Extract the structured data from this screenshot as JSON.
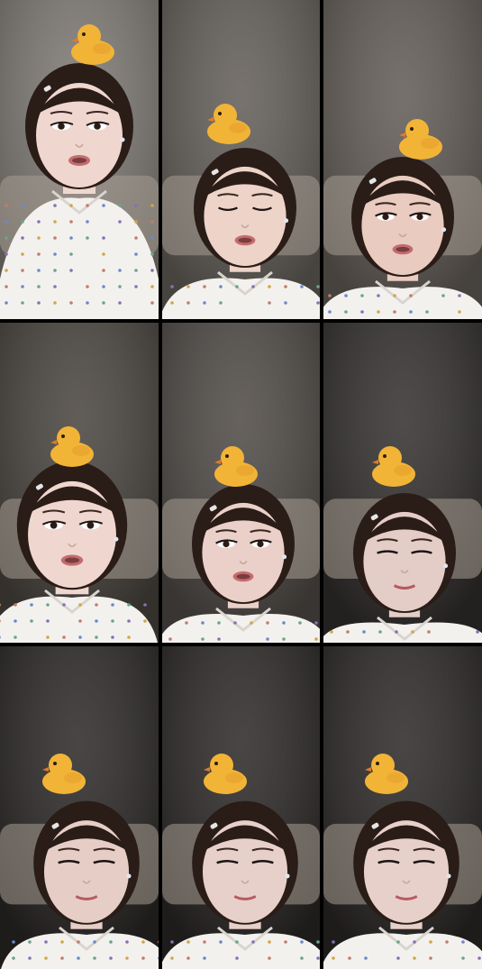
{
  "layout": "3x3 photo grid",
  "frames": [
    {
      "id": "frame-1",
      "background": "#7b7670",
      "skin": "#efd6cf",
      "eyes": "open",
      "mouth": "talking",
      "shirt": "polka-dot"
    },
    {
      "id": "frame-2",
      "background": "#5f5a55",
      "skin": "#edd3c8",
      "eyes": "closed",
      "mouth": "talking",
      "shirt": "polka-dot"
    },
    {
      "id": "frame-3",
      "background": "#5e5852",
      "skin": "#e9cbbf",
      "eyes": "open",
      "mouth": "talking",
      "shirt": "polka-dot"
    },
    {
      "id": "frame-4",
      "background": "#45403b",
      "skin": "#efd7cf",
      "eyes": "open",
      "mouth": "talking",
      "shirt": "polka-dot"
    },
    {
      "id": "frame-5",
      "background": "#4b4642",
      "skin": "#ead0c8",
      "eyes": "open",
      "mouth": "talking",
      "shirt": "polka-dot"
    },
    {
      "id": "frame-6",
      "background": "#2f2c2a",
      "skin": "#e4cdc6",
      "eyes": "squint",
      "mouth": "smile",
      "shirt": "polka-dot"
    },
    {
      "id": "frame-7",
      "background": "#282523",
      "skin": "#e6cec7",
      "eyes": "squint",
      "mouth": "smile",
      "shirt": "polka-dot"
    },
    {
      "id": "frame-8",
      "background": "#282523",
      "skin": "#e7d0c9",
      "eyes": "squint",
      "mouth": "smile",
      "shirt": "polka-dot"
    },
    {
      "id": "frame-9",
      "background": "#282523",
      "skin": "#e7d0c9",
      "eyes": "squint",
      "mouth": "smile",
      "shirt": "polka-dot"
    }
  ],
  "props": {
    "hat": "yellow-chick",
    "hat_color": "#f2b437"
  }
}
